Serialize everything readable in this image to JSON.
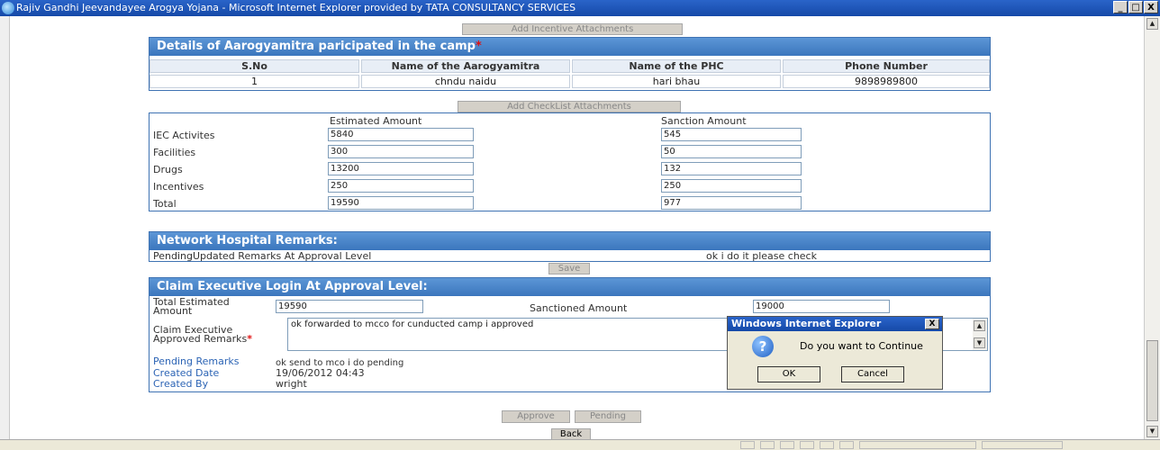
{
  "window": {
    "title": "Rajiv Gandhi Jeevandayee Arogya Yojana - Microsoft Internet Explorer provided by TATA CONSULTANCY SERVICES",
    "minimize": "_",
    "maximize": "□",
    "close": "X"
  },
  "buttons": {
    "add_incentive": "Add Incentive Attachments",
    "add_checklist": "Add CheckList Attachments",
    "save": "Save",
    "approve": "Approve",
    "pending": "Pending",
    "back": "Back"
  },
  "aarogyamitra": {
    "title": "Details of Aarogyamitra paricipated in the camp",
    "required_mark": "*",
    "columns": [
      "S.No",
      "Name of the Aarogyamitra",
      "Name of the PHC",
      "Phone Number"
    ],
    "rows": [
      [
        "1",
        "chndu naidu",
        "hari bhau",
        "9898989800"
      ]
    ]
  },
  "amounts": {
    "estimated_header": "Estimated Amount",
    "sanction_header": "Sanction Amount",
    "rows": [
      {
        "label": "IEC Activites",
        "estimated": "5840",
        "sanction": "545"
      },
      {
        "label": "Facilities",
        "estimated": "300",
        "sanction": "50"
      },
      {
        "label": "Drugs",
        "estimated": "13200",
        "sanction": "132"
      },
      {
        "label": "Incentives",
        "estimated": "250",
        "sanction": "250"
      },
      {
        "label": "Total",
        "estimated": "19590",
        "sanction": "977"
      }
    ]
  },
  "network_remarks": {
    "title": "Network Hospital Remarks:",
    "label": "PendingUpdated Remarks At Approval Level",
    "value": "ok i do it please check"
  },
  "claim_exec": {
    "title": "Claim Executive Login At Approval Level:",
    "total_estimated_label": "Total Estimated Amount",
    "total_estimated_value": "19590",
    "sanctioned_label": "Sanctioned Amount",
    "sanctioned_value": "19000",
    "approved_remarks_label": "Claim Executive Approved Remarks",
    "required_mark": "*",
    "approved_remarks_value": "ok forwarded to mcco for cunducted camp  i approved",
    "pending_remarks_label": "Pending Remarks",
    "pending_remarks_value": "ok send to mco i do pending",
    "created_date_label": "Created Date",
    "created_date_value": "19/06/2012 04:43",
    "created_by_label": "Created By",
    "created_by_value": "wright"
  },
  "dialog": {
    "title": "Windows Internet Explorer",
    "message": "Do you want to Continue",
    "ok": "OK",
    "cancel": "Cancel",
    "close": "X"
  }
}
